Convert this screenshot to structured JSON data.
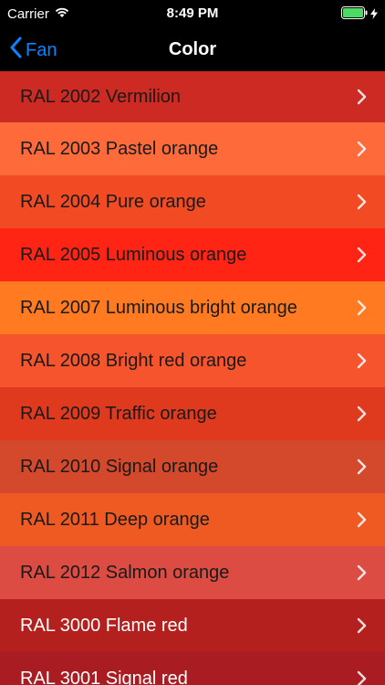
{
  "status_bar": {
    "carrier": "Carrier",
    "time": "8:49 PM",
    "icons": [
      "wifi-icon",
      "battery-icon",
      "charging-icon"
    ]
  },
  "nav": {
    "back_label": "Fan",
    "title": "Color",
    "accent": "#0a84ff"
  },
  "colors": [
    {
      "label": "RAL 2002 Vermilion",
      "bg": "#cc2a22",
      "light_text": false
    },
    {
      "label": "RAL 2003 Pastel orange",
      "bg": "#ff6a3a",
      "light_text": false
    },
    {
      "label": "RAL 2004 Pure orange",
      "bg": "#f24a22",
      "light_text": false
    },
    {
      "label": "RAL 2005 Luminous orange",
      "bg": "#ff2414",
      "light_text": false
    },
    {
      "label": "RAL 2007 Luminous bright orange",
      "bg": "#ff7a20",
      "light_text": false
    },
    {
      "label": "RAL 2008 Bright red orange",
      "bg": "#f6542c",
      "light_text": false
    },
    {
      "label": "RAL 2009 Traffic orange",
      "bg": "#e03a1e",
      "light_text": false
    },
    {
      "label": "RAL 2010 Signal orange",
      "bg": "#d4482c",
      "light_text": false
    },
    {
      "label": "RAL 2011 Deep orange",
      "bg": "#ee5a22",
      "light_text": false
    },
    {
      "label": "RAL 2012 Salmon orange",
      "bg": "#dc4c42",
      "light_text": false
    },
    {
      "label": "RAL 3000 Flame red",
      "bg": "#b4201e",
      "light_text": true
    },
    {
      "label": "RAL 3001 Signal red",
      "bg": "#a81c22",
      "light_text": true
    }
  ]
}
